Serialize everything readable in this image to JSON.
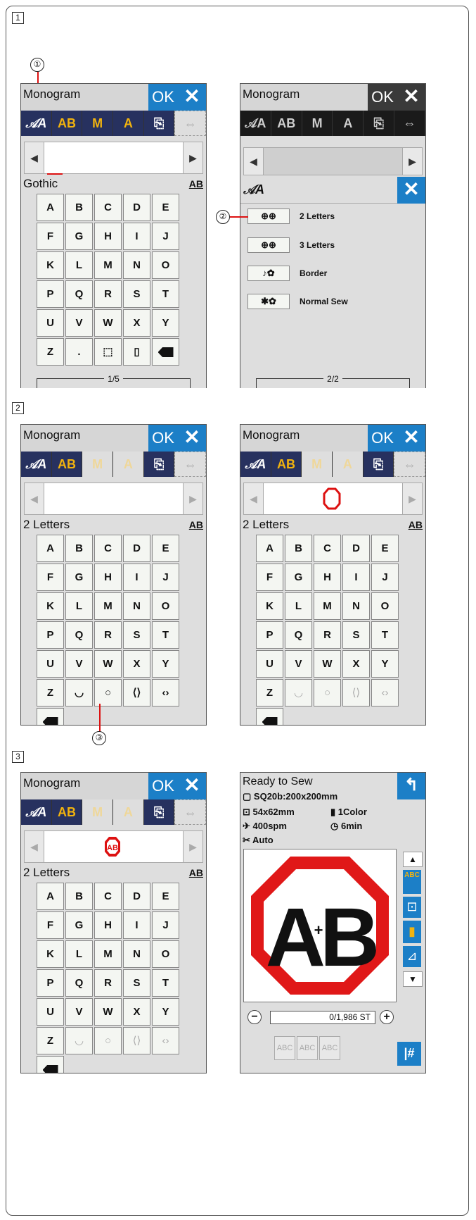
{
  "steps": {
    "s1": "1",
    "s2": "2",
    "s3": "3"
  },
  "callouts": {
    "c1": "①",
    "c2": "②",
    "c3": "③"
  },
  "common": {
    "title": "Monogram",
    "ok": "OK",
    "close": "✕",
    "ab": "AB"
  },
  "s1a": {
    "font": "Gothic",
    "page": "1/5"
  },
  "s1b": {
    "popup_icon": "𝒜A",
    "page": "2/2",
    "items": [
      {
        "icon": "⊕⊕",
        "label": "2 Letters"
      },
      {
        "icon": "⊕⊕",
        "label": "3 Letters"
      },
      {
        "icon": "♪✿",
        "label": "Border"
      },
      {
        "icon": "✱✿",
        "label": "Normal Sew"
      }
    ]
  },
  "keys1": [
    "A",
    "B",
    "C",
    "D",
    "E",
    "F",
    "G",
    "H",
    "I",
    "J",
    "K",
    "L",
    "M",
    "N",
    "O",
    "P",
    "Q",
    "R",
    "S",
    "T",
    "U",
    "V",
    "W",
    "X",
    "Y",
    "Z",
    ".",
    "⬚",
    "▯"
  ],
  "keys2": [
    "A",
    "B",
    "C",
    "D",
    "E",
    "F",
    "G",
    "H",
    "I",
    "J",
    "K",
    "L",
    "M",
    "N",
    "O",
    "P",
    "Q",
    "R",
    "S",
    "T",
    "U",
    "V",
    "W",
    "X",
    "Y",
    "Z",
    "◡",
    "○",
    "⟨⟩",
    "‹›"
  ],
  "s2": {
    "font": "2 Letters"
  },
  "ready": {
    "title": "Ready to Sew",
    "hoop": "SQ20b:200x200mm",
    "size": "54x62mm",
    "colors": "1Color",
    "speed": "400spm",
    "time": "6min",
    "auto": "Auto",
    "count": "0/1,986 ST",
    "abc": "ABC",
    "hash": "|#",
    "back": "↰"
  }
}
